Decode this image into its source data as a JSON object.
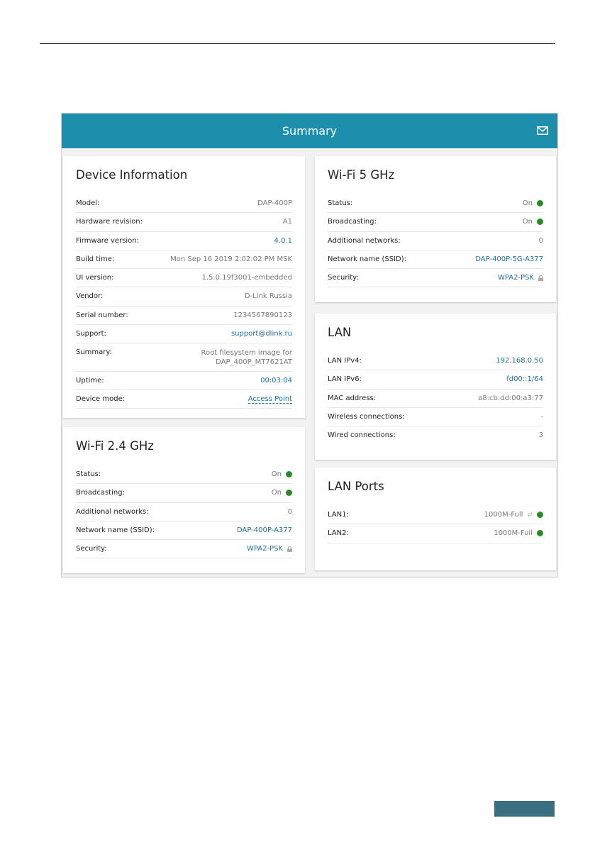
{
  "header": {
    "title": "Summary",
    "mail_icon": "mail-icon"
  },
  "colors": {
    "accent": "#1d8fac",
    "status_on": "#2a8a2a",
    "link": "#1d6fa3"
  },
  "device_info": {
    "title": "Device Information",
    "rows": [
      {
        "label": "Model:",
        "value": "DAP-400P"
      },
      {
        "label": "Hardware revision:",
        "value": "A1"
      },
      {
        "label": "Firmware version:",
        "value": "4.0.1"
      },
      {
        "label": "Build time:",
        "value": "Mon Sep 16 2019 2:02:02 PM MSK"
      },
      {
        "label": "UI version:",
        "value": "1.5.0.19f3001-embedded"
      },
      {
        "label": "Vendor:",
        "value": "D-Link Russia"
      },
      {
        "label": "Serial number:",
        "value": "1234567890123"
      },
      {
        "label": "Support:",
        "value": "support@dlink.ru"
      },
      {
        "label": "Summary:",
        "value": "Root filesystem image for DAP_400P_MT7621AT"
      },
      {
        "label": "Uptime:",
        "value": "00:03:04"
      },
      {
        "label": "Device mode:",
        "value": "Access Point"
      }
    ]
  },
  "wifi24": {
    "title": "Wi-Fi 2.4 GHz",
    "rows": [
      {
        "label": "Status:",
        "value": "On"
      },
      {
        "label": "Broadcasting:",
        "value": "On"
      },
      {
        "label": "Additional networks:",
        "value": "0"
      },
      {
        "label": "Network name (SSID):",
        "value": "DAP-400P-A377"
      },
      {
        "label": "Security:",
        "value": "WPA2-PSK"
      }
    ]
  },
  "wifi5": {
    "title": "Wi-Fi 5 GHz",
    "rows": [
      {
        "label": "Status:",
        "value": "On"
      },
      {
        "label": "Broadcasting:",
        "value": "On"
      },
      {
        "label": "Additional networks:",
        "value": "0"
      },
      {
        "label": "Network name (SSID):",
        "value": "DAP-400P-5G-A377"
      },
      {
        "label": "Security:",
        "value": "WPA2-PSK"
      }
    ]
  },
  "lan": {
    "title": "LAN",
    "rows": [
      {
        "label": "LAN IPv4:",
        "value": "192.168.0.50"
      },
      {
        "label": "LAN IPv6:",
        "value": "fd00::1/64"
      },
      {
        "label": "MAC address:",
        "value": "a8:cb:dd:00:a3:77"
      },
      {
        "label": "Wireless connections:",
        "value": "-"
      },
      {
        "label": "Wired connections:",
        "value": "3"
      }
    ]
  },
  "lan_ports": {
    "title": "LAN Ports",
    "rows": [
      {
        "label": "LAN1:",
        "value": "1000M-Full"
      },
      {
        "label": "LAN2:",
        "value": "1000M-Full"
      }
    ]
  }
}
